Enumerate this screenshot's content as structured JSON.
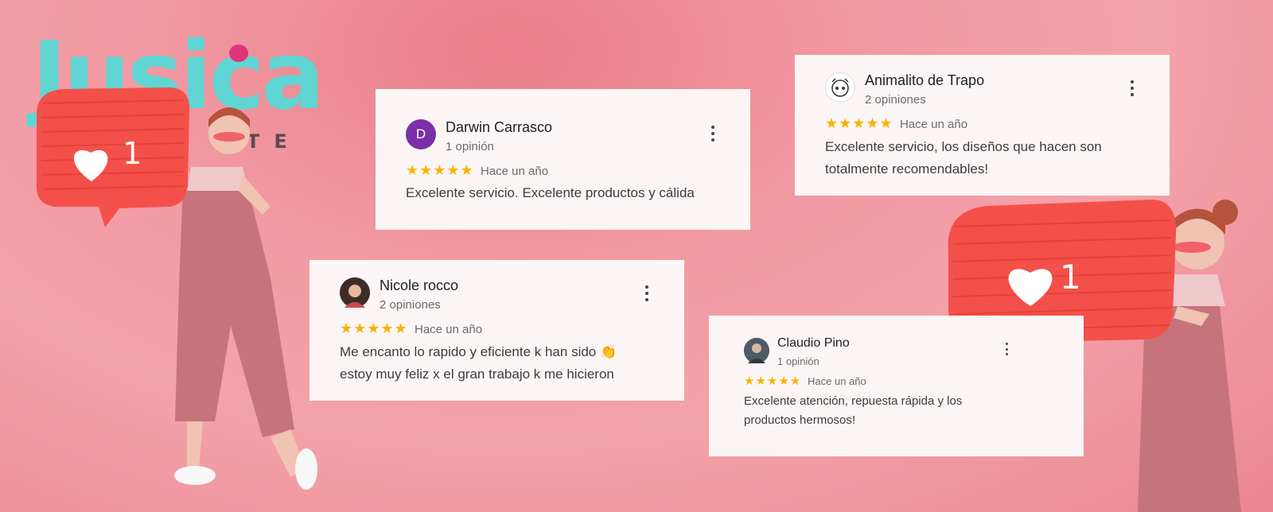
{
  "brand": {
    "logo_text": "Jusica",
    "logo_sub": "TE",
    "colors": {
      "logo": "#5fd6d4",
      "dot": "#e0357a",
      "pinata": "#f4504a",
      "background": "#f29aa3",
      "stars": "#f6b400",
      "avatar_d": "#7b2fa8"
    }
  },
  "pinata_left": {
    "like_count": "1",
    "icon": "heart-icon"
  },
  "pinata_right": {
    "like_count": "1",
    "icon": "heart-icon"
  },
  "reviews": [
    {
      "author": "Darwin Carrasco",
      "avatar_initial": "D",
      "count": "1 opinión",
      "stars": "★★★★★",
      "rating": 5,
      "date": "Hace un año",
      "text": "Excelente servicio. Excelente productos y cálida"
    },
    {
      "author": "Animalito de Trapo",
      "avatar_icon": "animal-logo-icon",
      "count": "2 opiniones",
      "stars": "★★★★★",
      "rating": 5,
      "date": "Hace un año",
      "text": "Excelente servicio, los diseños que hacen son totalmente recomendables!"
    },
    {
      "author": "Nicole rocco",
      "avatar_icon": "profile-photo-icon",
      "count": "2 opiniones",
      "stars": "★★★★★",
      "rating": 5,
      "date": "Hace un año",
      "text": "Me encanto lo rapido y eficiente k han sido 👏 estoy muy feliz x el gran trabajo k me hicieron"
    },
    {
      "author": "Claudio Pino",
      "avatar_icon": "profile-photo-icon",
      "count": "1 opinión",
      "stars": "★★★★★",
      "rating": 5,
      "date": "Hace un año",
      "text": "Excelente atención, repuesta rápida y los productos hermosos!"
    }
  ]
}
